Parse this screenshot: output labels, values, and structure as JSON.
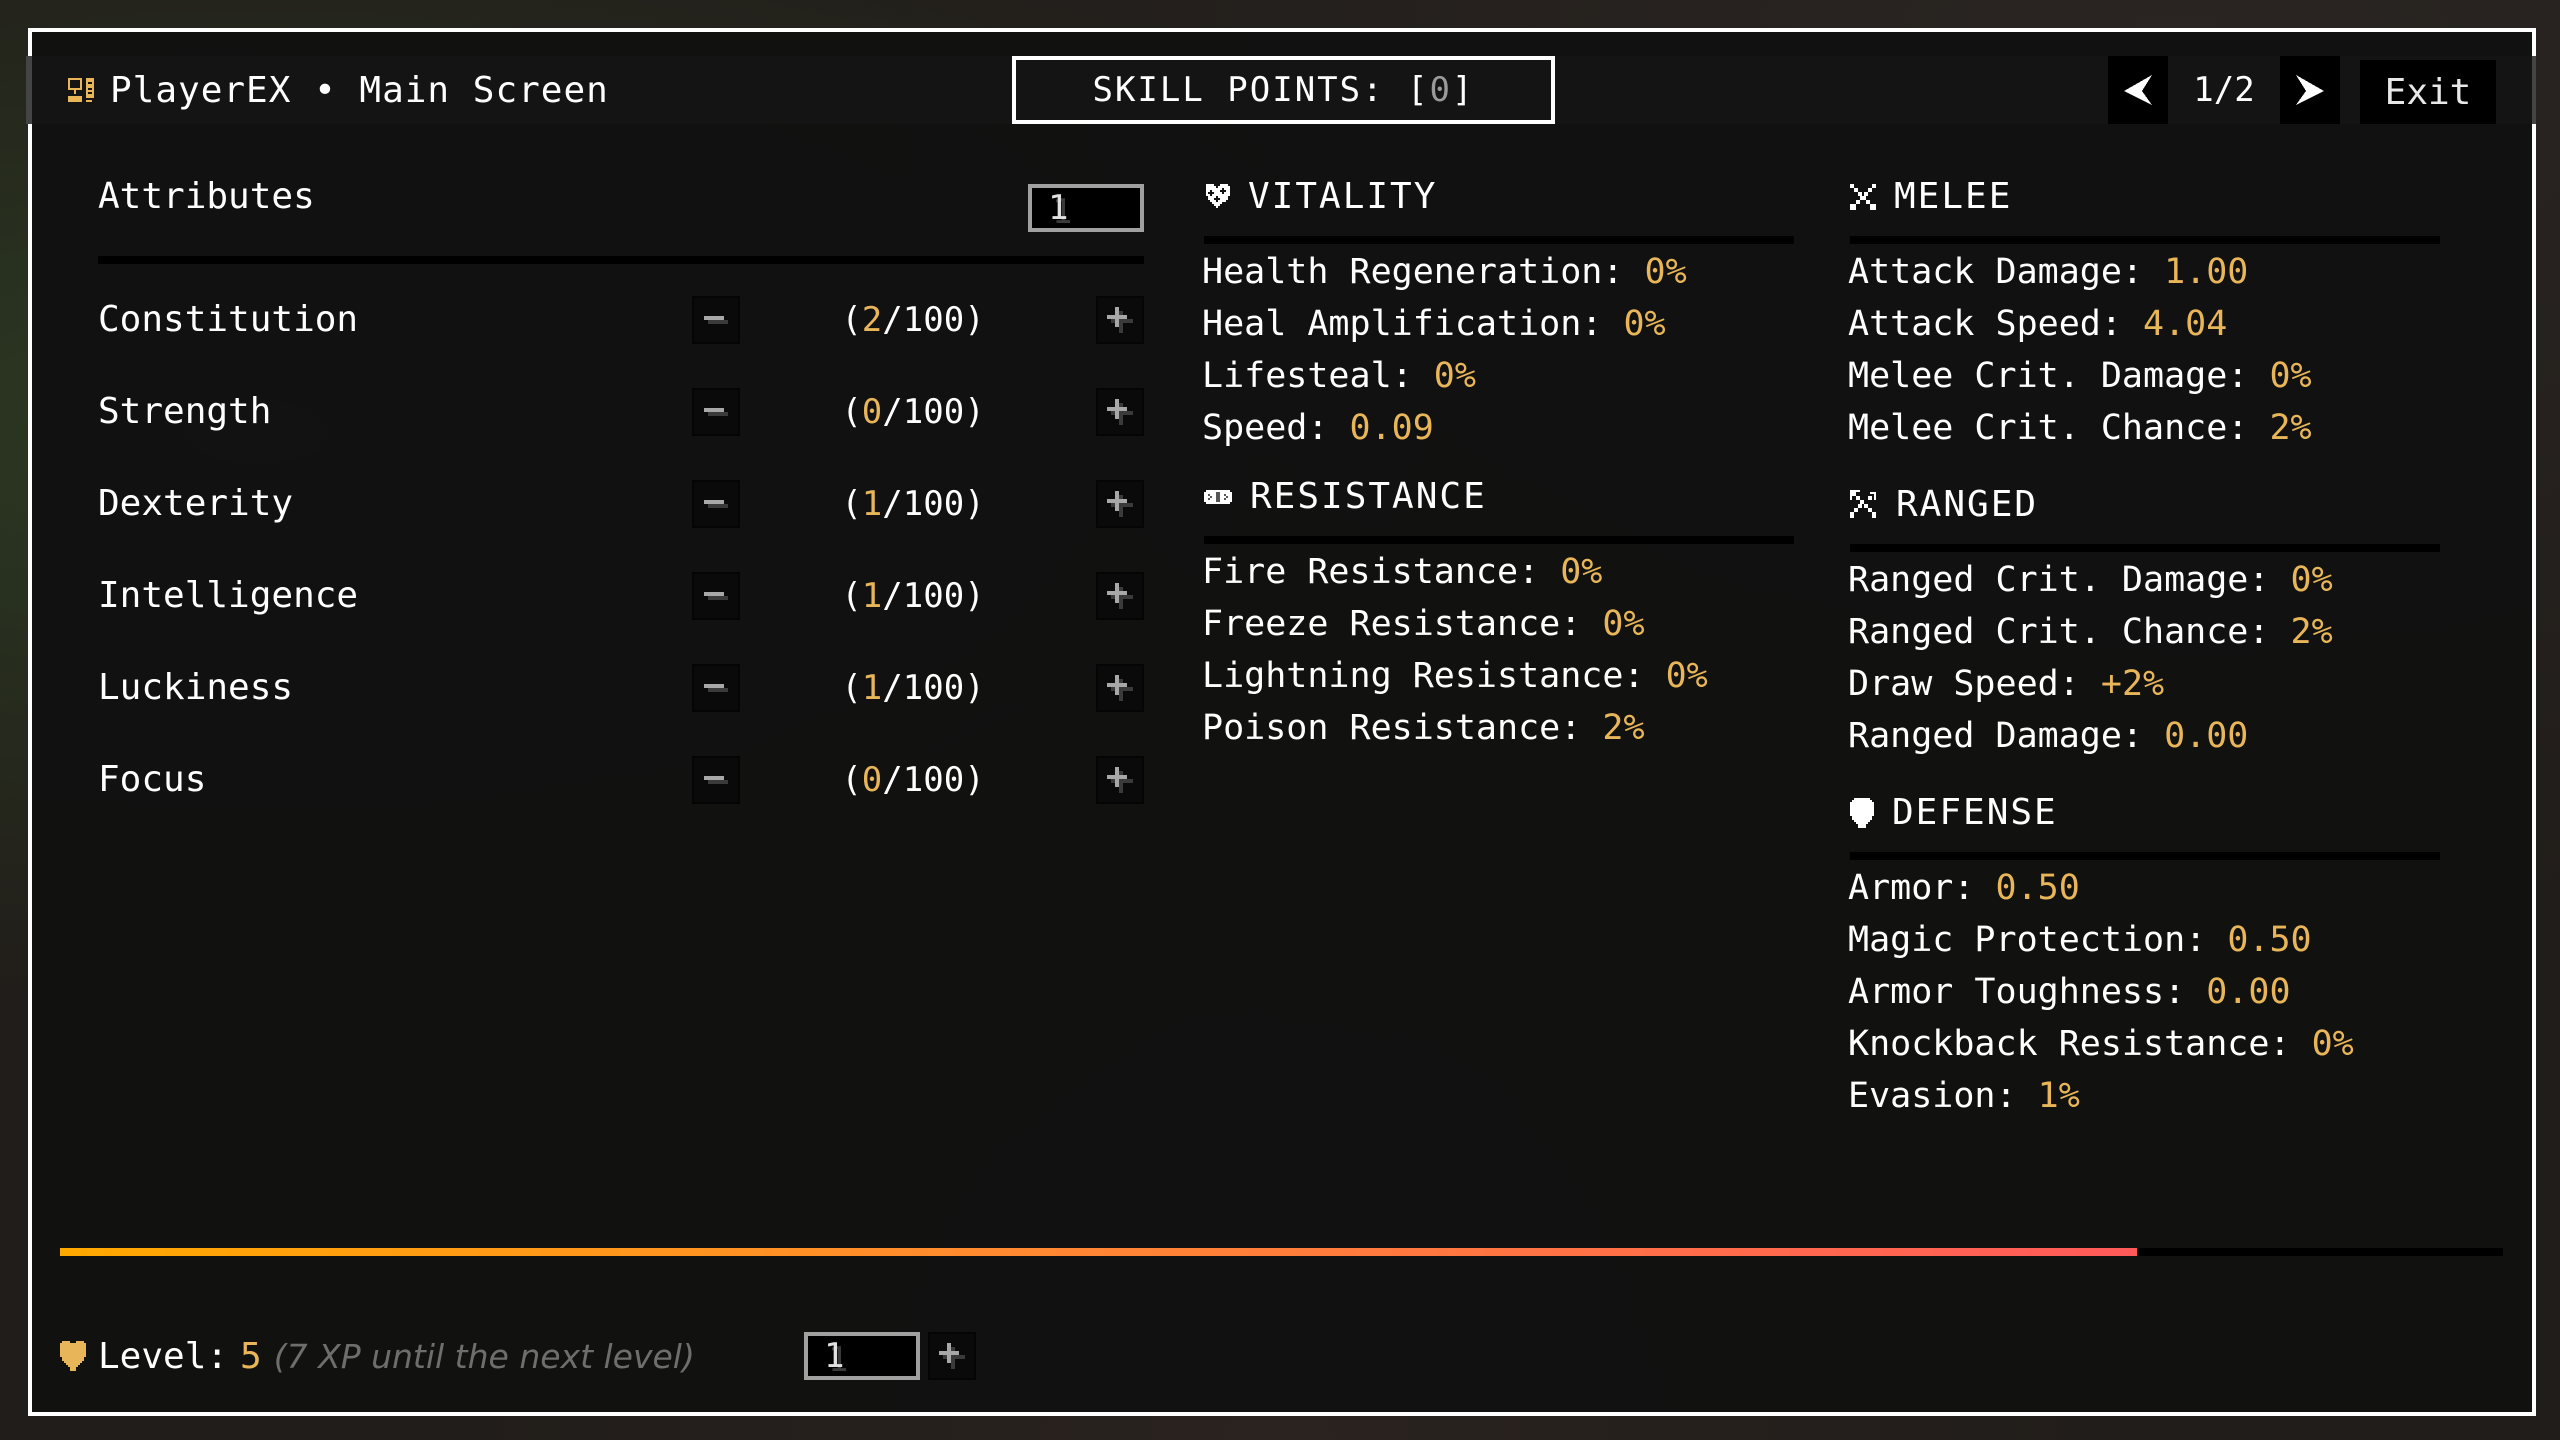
{
  "header": {
    "title": "PlayerEX • Main Screen",
    "icon": "computer-icon",
    "skill_points_label": "SKILL POINTS: [",
    "skill_points_value": "0",
    "skill_points_suffix": "]",
    "page_indicator": "1/2",
    "prev_icon": "chevron-left-icon",
    "next_icon": "chevron-right-icon",
    "exit_label": "Exit"
  },
  "attributes": {
    "heading": "Attributes",
    "step_input_value": "1",
    "items": [
      {
        "name": "Constitution",
        "value": "2",
        "max": "100"
      },
      {
        "name": "Strength",
        "value": "0",
        "max": "100"
      },
      {
        "name": "Dexterity",
        "value": "1",
        "max": "100"
      },
      {
        "name": "Intelligence",
        "value": "1",
        "max": "100"
      },
      {
        "name": "Luckiness",
        "value": "1",
        "max": "100"
      },
      {
        "name": "Focus",
        "value": "0",
        "max": "100"
      }
    ]
  },
  "sections": {
    "vitality": {
      "title": "VITALITY",
      "icon": "heart-icon",
      "stats": [
        {
          "label": "Health Regeneration:",
          "value": "0%"
        },
        {
          "label": "Heal Amplification:",
          "value": "0%"
        },
        {
          "label": "Lifesteal:",
          "value": "0%"
        },
        {
          "label": "Speed:",
          "value": "0.09"
        }
      ]
    },
    "resistance": {
      "title": "RESISTANCE",
      "icon": "bandage-icon",
      "stats": [
        {
          "label": "Fire Resistance:",
          "value": "0%"
        },
        {
          "label": "Freeze Resistance:",
          "value": "0%"
        },
        {
          "label": "Lightning Resistance:",
          "value": "0%"
        },
        {
          "label": "Poison Resistance:",
          "value": "2%"
        }
      ]
    },
    "melee": {
      "title": "MELEE",
      "icon": "crossed-swords-icon",
      "stats": [
        {
          "label": "Attack Damage:",
          "value": "1.00"
        },
        {
          "label": "Attack Speed:",
          "value": "4.04"
        },
        {
          "label": "Melee Crit. Damage:",
          "value": "0%"
        },
        {
          "label": "Melee Crit. Chance:",
          "value": "2%"
        }
      ]
    },
    "ranged": {
      "title": "RANGED",
      "icon": "bow-arrow-icon",
      "stats": [
        {
          "label": "Ranged Crit. Damage:",
          "value": "0%"
        },
        {
          "label": "Ranged Crit. Chance:",
          "value": "2%"
        },
        {
          "label": "Draw Speed:",
          "value": "+2%"
        },
        {
          "label": "Ranged Damage:",
          "value": "0.00"
        }
      ]
    },
    "defense": {
      "title": "DEFENSE",
      "icon": "shield-icon",
      "stats": [
        {
          "label": "Armor:",
          "value": "0.50"
        },
        {
          "label": "Magic Protection:",
          "value": "0.50"
        },
        {
          "label": "Armor Toughness:",
          "value": "0.00"
        },
        {
          "label": "Knockback Resistance:",
          "value": "0%"
        },
        {
          "label": "Evasion:",
          "value": "1%"
        }
      ]
    }
  },
  "level": {
    "label": "Level:",
    "value": "5",
    "hint": "(7 XP until the next level)",
    "input_value": "1",
    "xp_progress_fraction": 0.85,
    "icon": "heart-icon"
  },
  "colors": {
    "accent": "#e8b658",
    "xp_start": "#ffa800",
    "xp_end": "#ff5a5a"
  }
}
